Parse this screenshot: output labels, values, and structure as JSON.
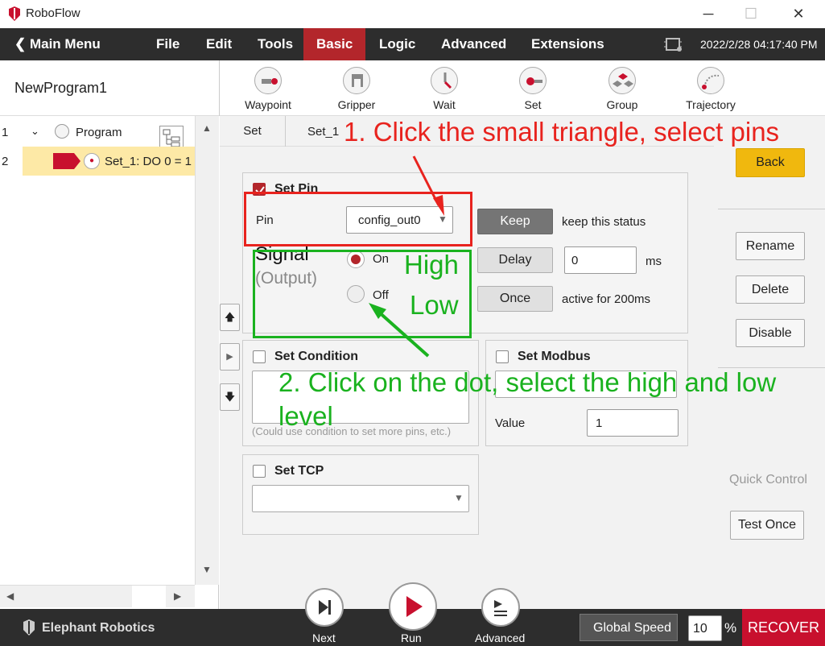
{
  "app": {
    "title": "RoboFlow"
  },
  "menu": {
    "back_label": "Main Menu",
    "items": [
      "File",
      "Edit",
      "Tools",
      "Basic",
      "Logic",
      "Advanced",
      "Extensions"
    ],
    "active": "Basic",
    "datetime": "2022/2/28 04:17:40 PM"
  },
  "program_name": "NewProgram1",
  "toolbar": {
    "items": [
      "Waypoint",
      "Gripper",
      "Wait",
      "Set",
      "Group",
      "Trajectory"
    ]
  },
  "tree": {
    "rows": [
      {
        "num": "1",
        "label": "Program"
      },
      {
        "num": "2",
        "label": "Set_1: DO 0 = 1"
      }
    ]
  },
  "tabs": [
    "Set",
    "Set_1"
  ],
  "set_pin": {
    "label": "Set Pin",
    "pin_label": "Pin",
    "pin_value": "config_out0",
    "signal_label": "Signal",
    "signal_sub": "(Output)",
    "on_label": "On",
    "off_label": "Off",
    "keep_button": "Keep",
    "keep_text": "keep this status",
    "delay_button": "Delay",
    "delay_value": "0",
    "delay_unit": "ms",
    "once_button": "Once",
    "once_text": "active for 200ms"
  },
  "set_condition": {
    "label": "Set Condition",
    "hint": "(Could use condition to set more pins, etc.)"
  },
  "set_modbus": {
    "label": "Set Modbus",
    "value_label": "Value",
    "value": "1"
  },
  "set_tcp": {
    "label": "Set TCP"
  },
  "right": {
    "back": "Back",
    "rename": "Rename",
    "delete": "Delete",
    "disable": "Disable",
    "quick_control": "Quick Control",
    "test_once": "Test Once"
  },
  "bottom": {
    "brand": "Elephant Robotics",
    "next": "Next",
    "run": "Run",
    "advanced": "Advanced",
    "global_speed": "Global Speed",
    "speed_value": "10",
    "percent": "%",
    "recover": "RECOVER"
  },
  "annotations": {
    "step1": "1. Click the small triangle, select pins",
    "high": "High",
    "low": "Low",
    "step2": "2. Click on the dot, select the high and low level"
  },
  "colors": {
    "accent": "#b3262b",
    "highlight_row": "#fde9a6",
    "back_button": "#f0b80e",
    "annot_red": "#e8231e",
    "annot_green": "#1ab21f"
  }
}
